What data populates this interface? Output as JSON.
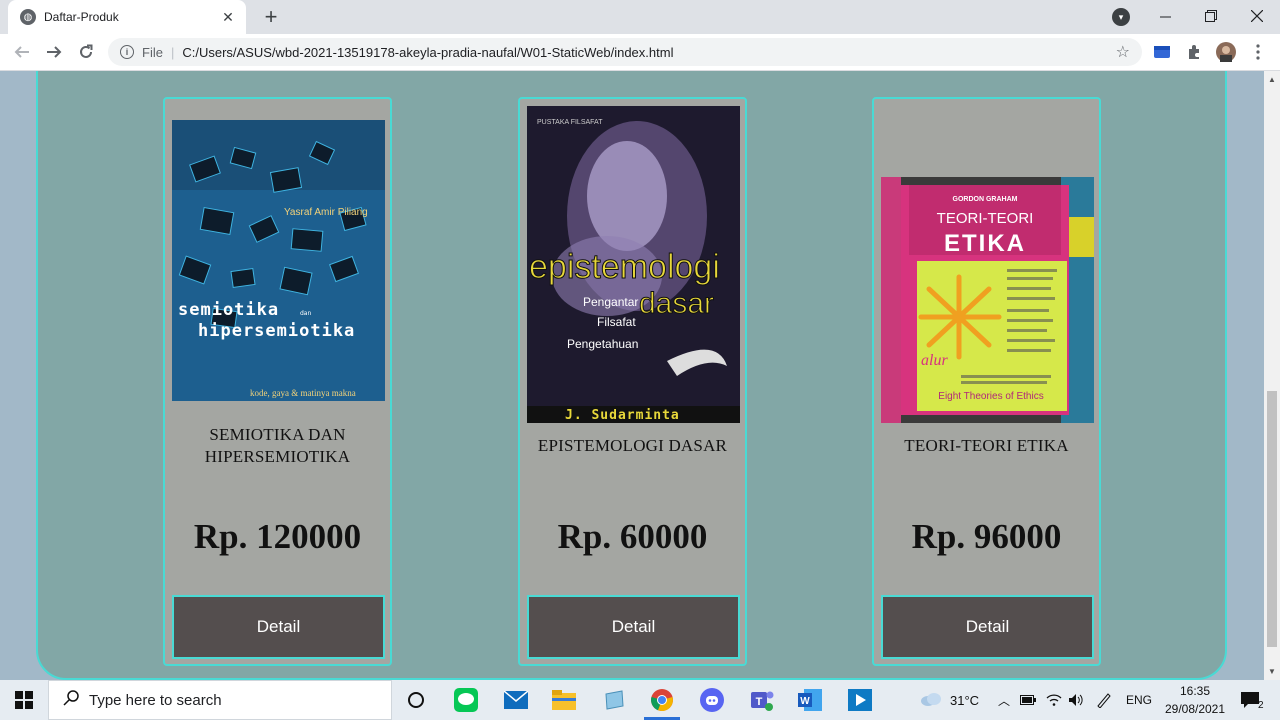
{
  "browser": {
    "tab_title": "Daftar-Produk",
    "tab_close": "✕",
    "new_tab": "+",
    "address_scheme_label": "File",
    "address_url": "C:/Users/ASUS/wbd-2021-13519178-akeyla-pradia-naufal/W01-StaticWeb/index.html"
  },
  "products": [
    {
      "name": "SEMIOTIKA DAN HIPERSEMIOTIKA",
      "price": "Rp. 120000",
      "button": "Detail",
      "cover": {
        "author": "Yasraf Amir Piliang",
        "title_line1": "semiotika",
        "title_small": "dan",
        "title_line2": "hipersemiotika",
        "subtitle": "kode, gaya & matinya makna"
      }
    },
    {
      "name": "EPISTEMOLOGI DASAR",
      "price": "Rp. 60000",
      "button": "Detail",
      "cover": {
        "publisher": "PUSTAKA FILSAFAT",
        "title_line1": "epistemologi",
        "title_line2": "dasar",
        "subtitle_1": "Pengantar",
        "subtitle_2": "Filsafat",
        "subtitle_3": "Pengetahuan",
        "author": "J. Sudarminta"
      }
    },
    {
      "name": "TEORI-TEORI ETIKA",
      "price": "Rp. 96000",
      "button": "Detail",
      "cover": {
        "author": "GORDON GRAHAM",
        "title_line1": "TEORI-TEORI",
        "title_line2": "ETIKA",
        "subtitle": "Eight Theories of Ethics",
        "publisher_mark": "alur"
      }
    }
  ],
  "taskbar": {
    "search_placeholder": "Type here to search",
    "weather": "31°C",
    "language": "ENG",
    "time": "16:35",
    "date": "29/08/2021",
    "notification_count": "2"
  }
}
